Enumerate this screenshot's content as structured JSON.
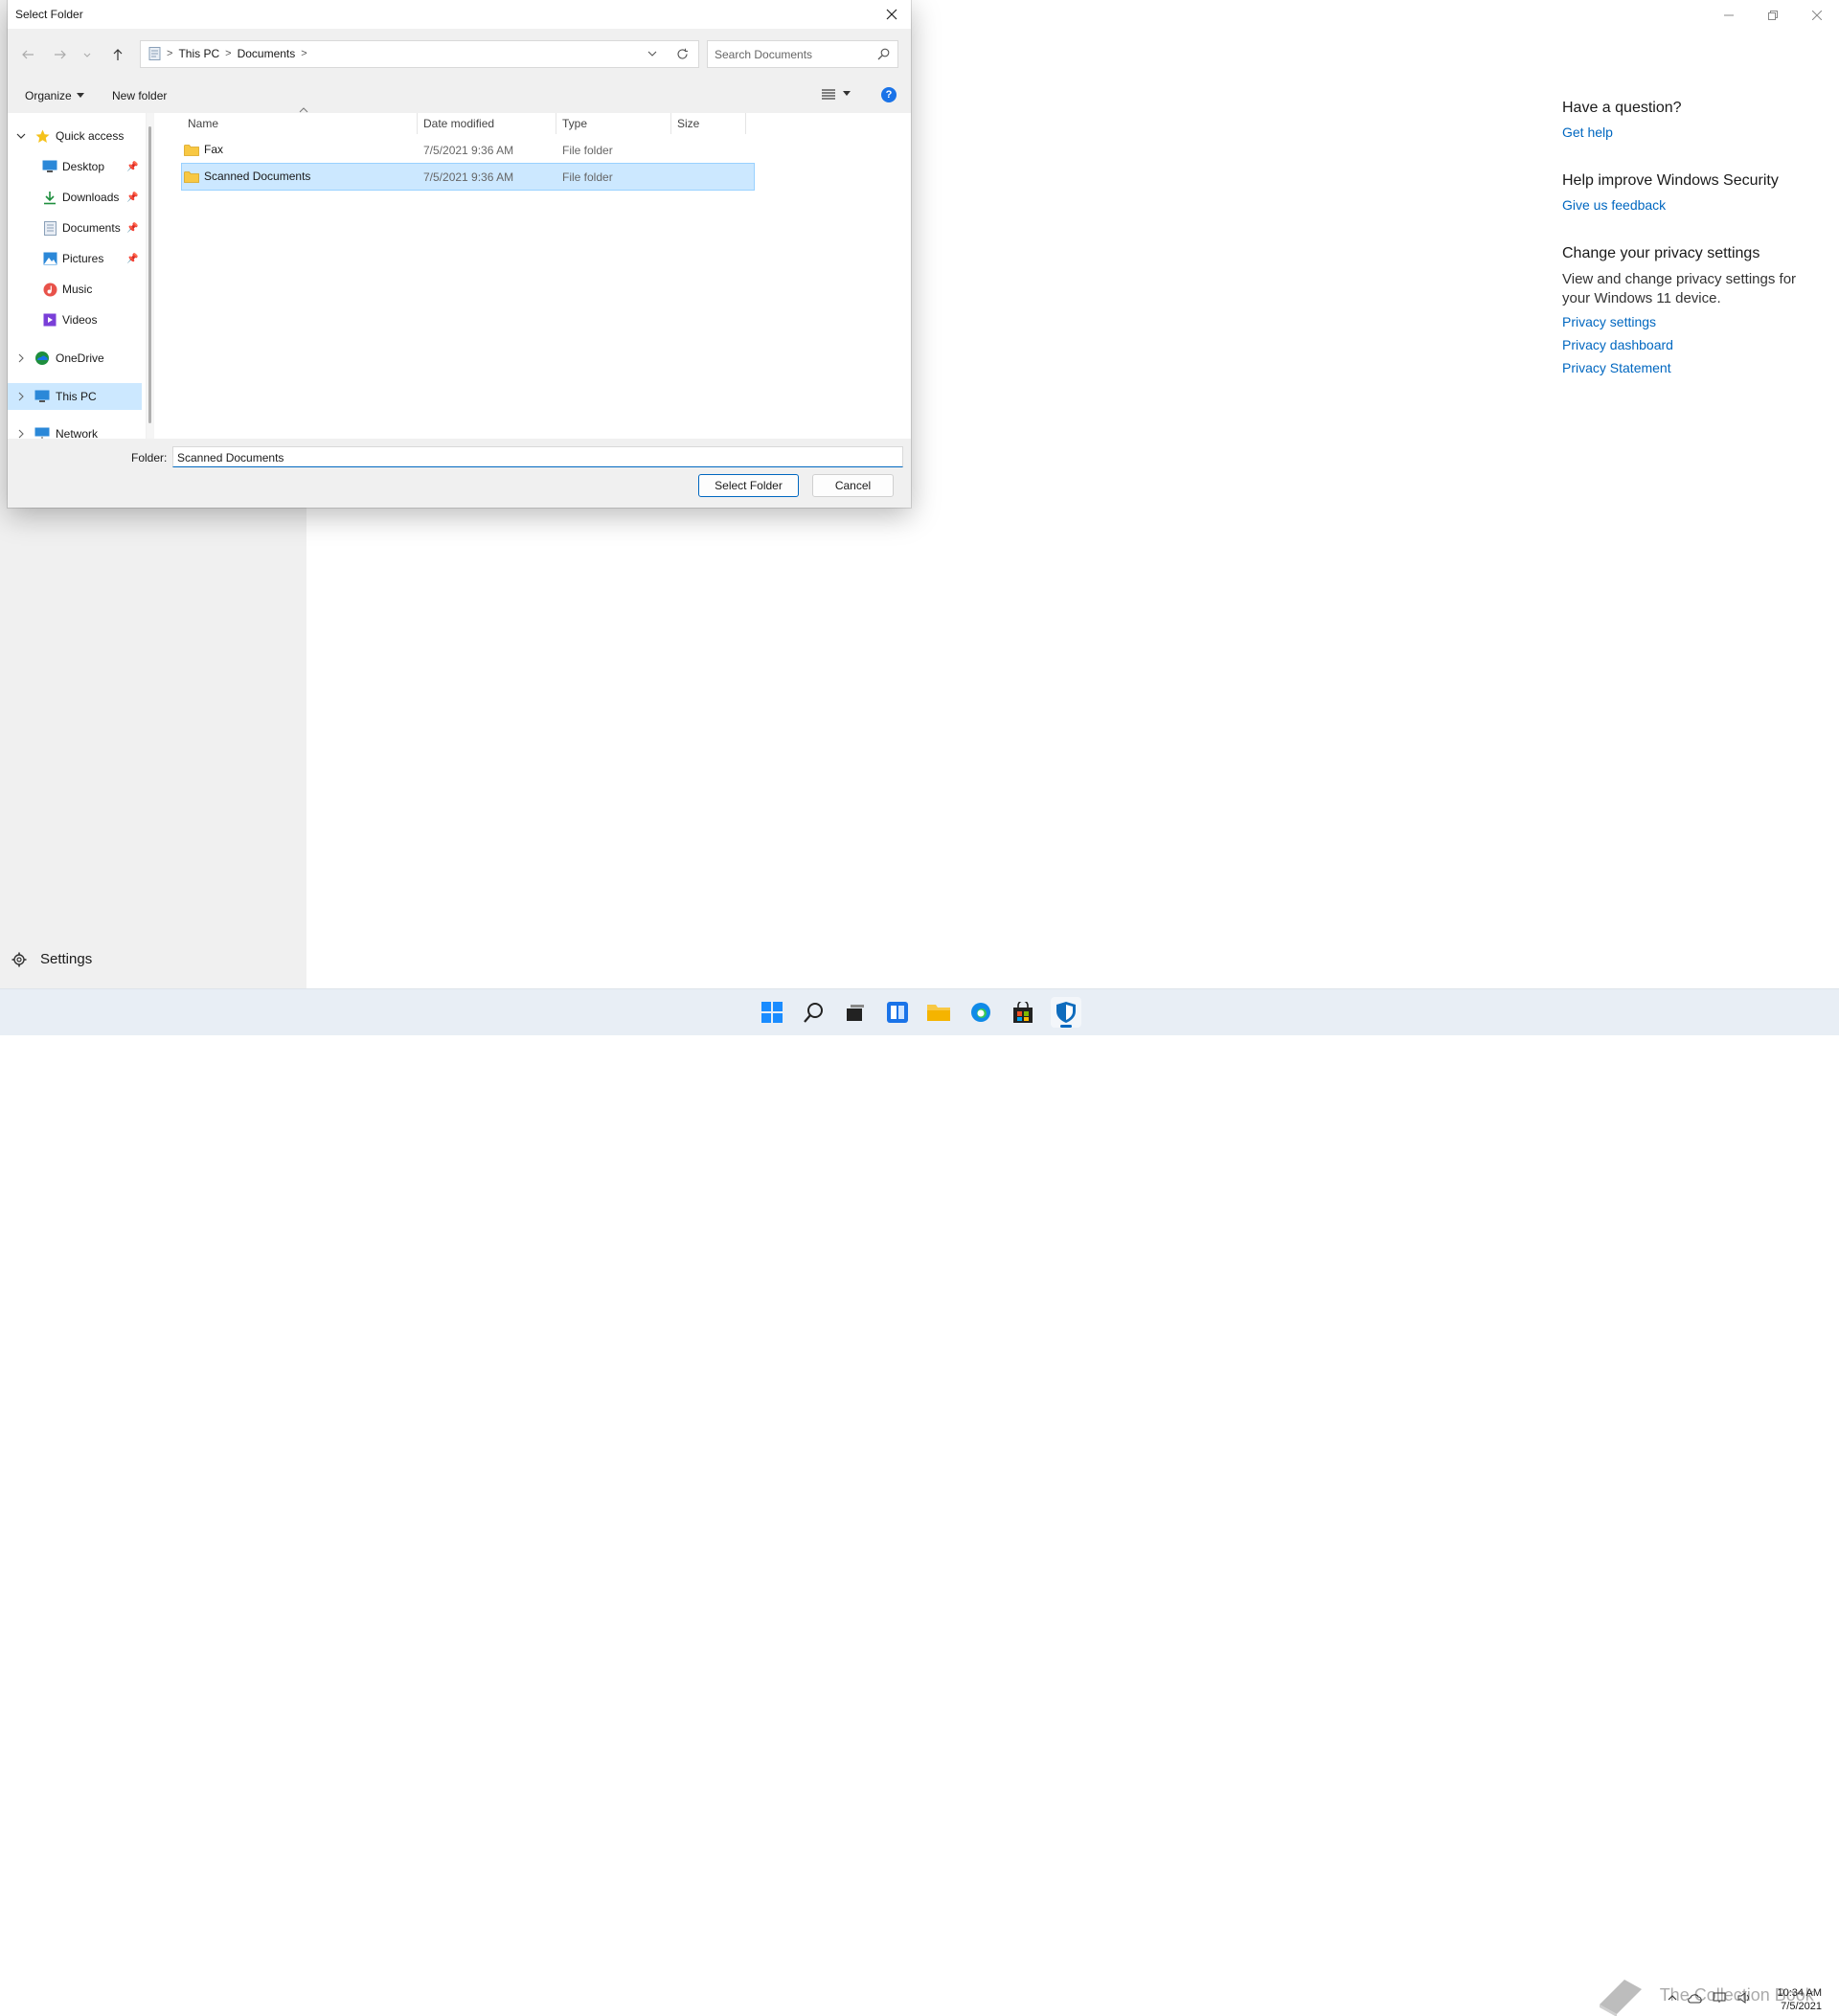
{
  "background_app": {
    "settings_label": "Settings",
    "right_panel": {
      "question": {
        "heading": "Have a question?",
        "link": "Get help"
      },
      "improve": {
        "heading": "Help improve Windows Security",
        "link": "Give us feedback"
      },
      "privacy": {
        "heading": "Change your privacy settings",
        "text": "View and change privacy settings for your Windows 11 device.",
        "links": [
          "Privacy settings",
          "Privacy dashboard",
          "Privacy Statement"
        ]
      }
    }
  },
  "dialog": {
    "title": "Select Folder",
    "breadcrumb": [
      "This PC",
      "Documents"
    ],
    "search_placeholder": "Search Documents",
    "toolbar": {
      "organize": "Organize",
      "new_folder": "New folder"
    },
    "nav": {
      "quick_access": "Quick access",
      "items": [
        {
          "label": "Desktop",
          "icon": "desktop-icon",
          "pinned": true
        },
        {
          "label": "Downloads",
          "icon": "downloads-icon",
          "pinned": true
        },
        {
          "label": "Documents",
          "icon": "documents-icon",
          "pinned": true
        },
        {
          "label": "Pictures",
          "icon": "pictures-icon",
          "pinned": true
        },
        {
          "label": "Music",
          "icon": "music-icon",
          "pinned": false
        },
        {
          "label": "Videos",
          "icon": "videos-icon",
          "pinned": false
        }
      ],
      "onedrive": "OneDrive",
      "this_pc": "This PC",
      "network": "Network"
    },
    "columns": [
      "Name",
      "Date modified",
      "Type",
      "Size"
    ],
    "files": [
      {
        "name": "Fax",
        "date": "7/5/2021 9:36 AM",
        "type": "File folder",
        "size": "",
        "selected": false
      },
      {
        "name": "Scanned Documents",
        "date": "7/5/2021 9:36 AM",
        "type": "File folder",
        "size": "",
        "selected": true
      }
    ],
    "folder_label": "Folder:",
    "folder_value": "Scanned Documents",
    "select_button": "Select Folder",
    "cancel_button": "Cancel"
  },
  "taskbar": {
    "watermark": "The Collection Book",
    "time": "10:34 AM",
    "date": "7/5/2021"
  },
  "colors": {
    "accent": "#0067c0",
    "selection": "#cce8ff",
    "folder": "#f8c843"
  }
}
